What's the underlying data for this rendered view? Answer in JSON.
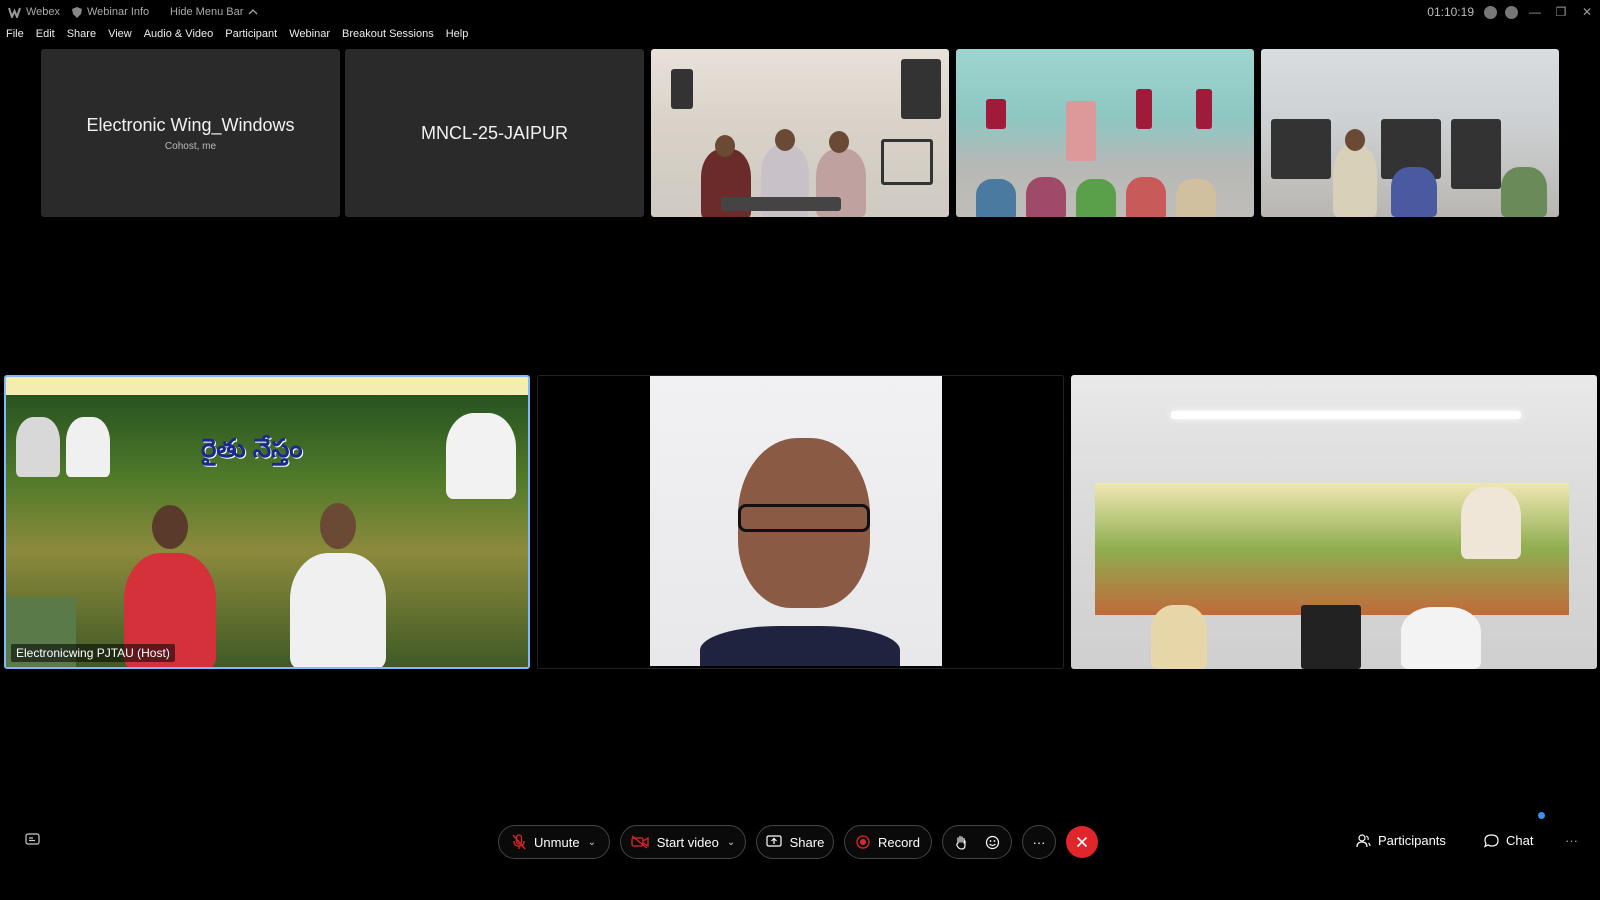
{
  "titlebar": {
    "app_name": "Webex",
    "webinar_info": "Webinar Info",
    "hide_menu": "Hide Menu Bar",
    "timer": "01:10:19"
  },
  "menu": [
    "File",
    "Edit",
    "Share",
    "View",
    "Audio & Video",
    "Participant",
    "Webinar",
    "Breakout Sessions",
    "Help"
  ],
  "tiles": {
    "tile1": {
      "name": "Electronic Wing_Windows",
      "sub": "Cohost, me"
    },
    "tile2": {
      "name": "MNCL-25-JAIPUR"
    },
    "host_label": "Electronicwing PJTAU (Host)",
    "banner_title": "రైతు నేస్తం"
  },
  "controls": {
    "unmute": "Unmute",
    "start_video": "Start video",
    "share": "Share",
    "record": "Record",
    "more": "···",
    "participants": "Participants",
    "chat": "Chat",
    "overflow": "···"
  },
  "icons": [
    "webex-logo-icon",
    "shield-icon",
    "chevron-up-icon",
    "record-indicator-icon",
    "mic-off-icon",
    "video-off-icon",
    "share-icon",
    "record-icon",
    "raise-hand-icon",
    "reaction-icon",
    "close-icon",
    "participants-icon",
    "chat-icon",
    "captions-icon"
  ],
  "colors": {
    "accent": "#7fb8ff",
    "end_button": "#e0252b",
    "badge": "#3b8ef5"
  }
}
